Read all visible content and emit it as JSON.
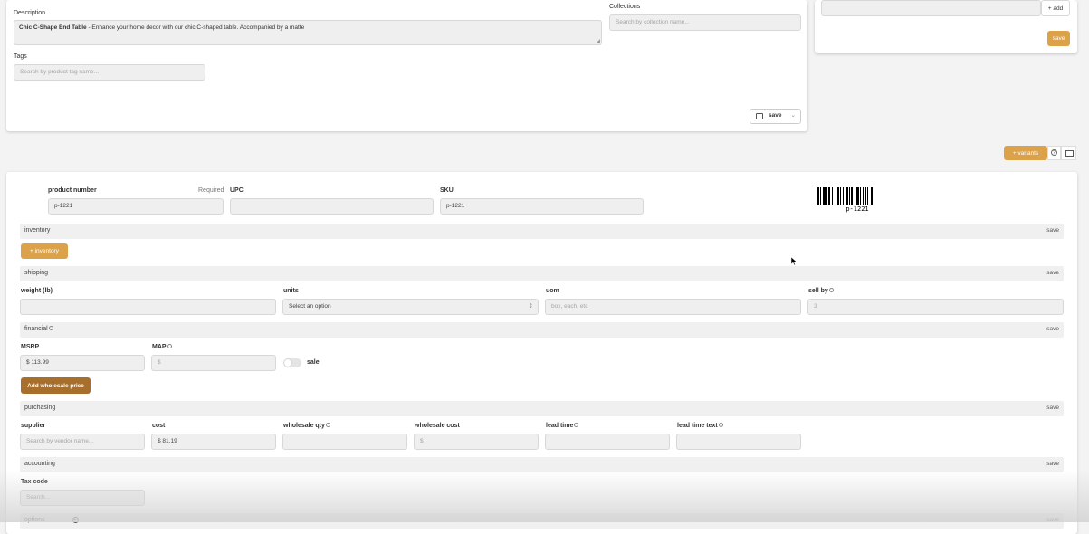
{
  "description_card": {
    "description_label": "Description",
    "description_bold": "Chic C-Shape End Table",
    "description_rest": " - Enhance your home decor with our chic C-shaped table. Accompanied by a matte",
    "collections_label": "Collections",
    "collections_placeholder": "Search by collection name...",
    "tags_label": "Tags",
    "tags_placeholder": "Search by product tag name...",
    "save_label": "save"
  },
  "side_card": {
    "add_label": "+ add",
    "save_label": "save"
  },
  "toolbar": {
    "variants_label": "+ variants"
  },
  "product": {
    "product_number_label": "product number",
    "required_label": "Required",
    "product_number_value": "p-1221",
    "upc_label": "UPC",
    "upc_value": "",
    "sku_label": "SKU",
    "sku_value": "p-1221",
    "barcode_text": "p-1221"
  },
  "inventory": {
    "title": "inventory",
    "save": "save",
    "add_button": "+ inventory"
  },
  "shipping": {
    "title": "shipping",
    "save": "save",
    "weight_label": "weight (lb)",
    "units_label": "units",
    "units_selected": "Select an option",
    "uom_label": "uom",
    "uom_placeholder": "box, each, etc",
    "sell_by_label": "sell by",
    "sell_by_placeholder": "3"
  },
  "financial": {
    "title": "financial",
    "save": "save",
    "msrp_label": "MSRP",
    "msrp_value": "$ 113.99",
    "map_label": "MAP",
    "map_placeholder": "$",
    "sale_label": "sale",
    "wholesale_button": "Add wholesale price"
  },
  "purchasing": {
    "title": "purchasing",
    "save": "save",
    "supplier_label": "supplier",
    "supplier_placeholder": "Search by vendor name...",
    "cost_label": "cost",
    "cost_value": "$ 81.19",
    "wholesale_qty_label": "wholesale qty",
    "wholesale_cost_label": "wholesale cost",
    "wholesale_cost_placeholder": "$",
    "lead_time_label": "lead time",
    "lead_time_text_label": "lead time text"
  },
  "accounting": {
    "title": "accounting",
    "save": "save",
    "tax_code_label": "Tax code",
    "tax_code_placeholder": "Search..."
  },
  "options": {
    "title": "options",
    "save": "save"
  }
}
